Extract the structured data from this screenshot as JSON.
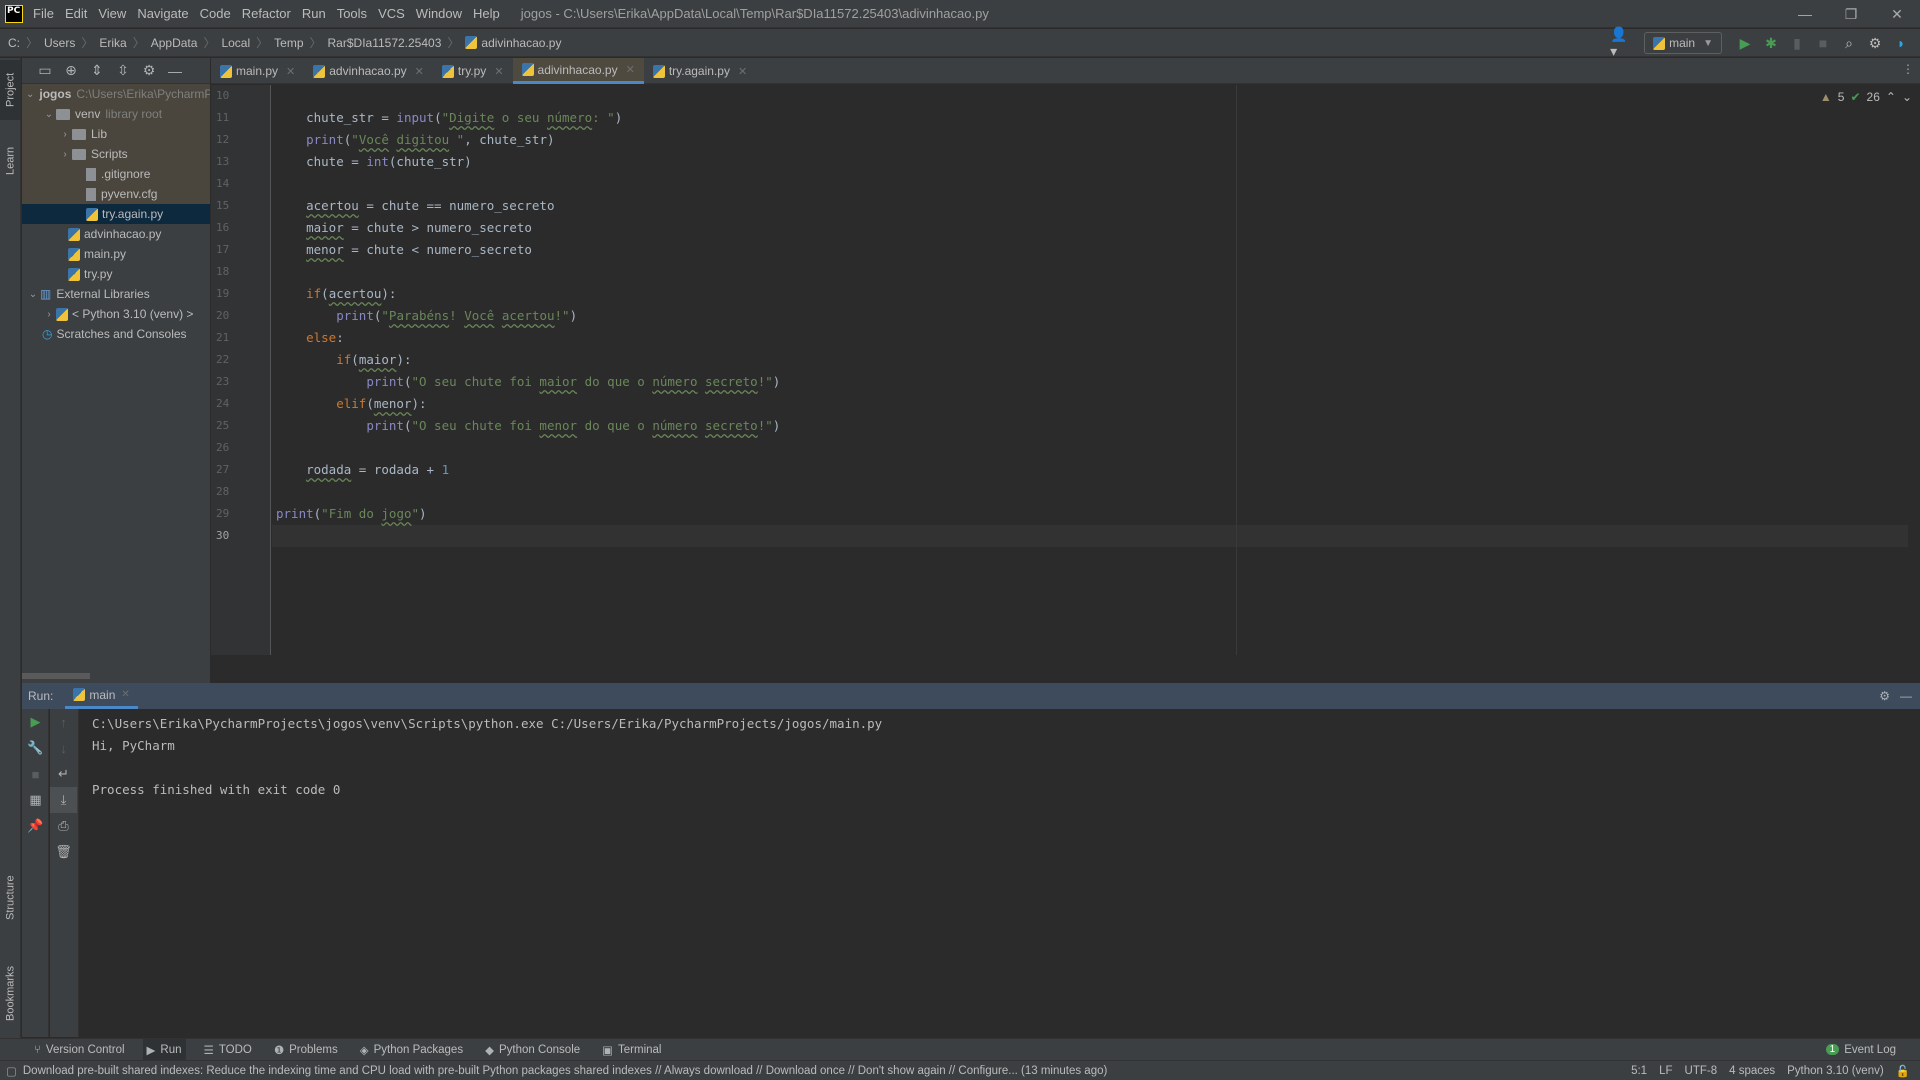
{
  "titlebar": {
    "logo": "PC",
    "menu": [
      "File",
      "Edit",
      "View",
      "Navigate",
      "Code",
      "Refactor",
      "Run",
      "Tools",
      "VCS",
      "Window",
      "Help"
    ],
    "title": "jogos - C:\\Users\\Erika\\AppData\\Local\\Temp\\Rar$DIa11572.25403\\adivinhacao.py",
    "controls": {
      "minimize": "—",
      "restore": "❐",
      "close": "✕"
    }
  },
  "navbar": {
    "breadcrumbs": [
      "C:",
      "Users",
      "Erika",
      "AppData",
      "Local",
      "Temp",
      "Rar$DIa11572.25403",
      "adivinhacao.py"
    ],
    "run_config": "main"
  },
  "left_stripe": {
    "tabs": [
      "Project",
      "Learn",
      "Structure",
      "Bookmarks"
    ]
  },
  "project_tree": [
    {
      "label": "jogos",
      "extra": "C:\\Users\\Erika\\PycharmProjects\\jogos",
      "type": "folder",
      "level": 0,
      "expanded": true
    },
    {
      "label": "venv",
      "extra": "library root",
      "type": "folder",
      "level": 1,
      "expanded": true
    },
    {
      "label": "Lib",
      "type": "folder",
      "level": 2,
      "expanded": false
    },
    {
      "label": "Scripts",
      "type": "folder",
      "level": 2,
      "expanded": false
    },
    {
      "label": ".gitignore",
      "type": "file",
      "level": 3
    },
    {
      "label": "pyvenv.cfg",
      "type": "file",
      "level": 3
    },
    {
      "label": "try.again.py",
      "type": "py",
      "level": 3,
      "selected": true
    },
    {
      "label": "advinhacao.py",
      "type": "py",
      "level": 2
    },
    {
      "label": "main.py",
      "type": "py",
      "level": 2
    },
    {
      "label": "try.py",
      "type": "py",
      "level": 2
    },
    {
      "label": "External Libraries",
      "type": "lib",
      "level": 0,
      "expanded": true
    },
    {
      "label": "< Python 3.10 (venv) >",
      "type": "python",
      "level": 1,
      "expanded": false
    },
    {
      "label": "Scratches and Consoles",
      "type": "scratch",
      "level": 0
    }
  ],
  "tabs": [
    {
      "label": "main.py",
      "active": false
    },
    {
      "label": "advinhacao.py",
      "active": false
    },
    {
      "label": "try.py",
      "active": false
    },
    {
      "label": "adivinhacao.py",
      "active": true
    },
    {
      "label": "try.again.py",
      "active": false
    }
  ],
  "inspections": {
    "warnings": "5",
    "typos": "26"
  },
  "editor": {
    "current_line": 30,
    "lines": [
      {
        "n": 10,
        "html": ""
      },
      {
        "n": 11,
        "html": "    chute_str = <span class='fn'>input</span>(<span class='st'>\"<span class='wv'>Digite</span> o seu <span class='wv'>número</span>: \"</span>)"
      },
      {
        "n": 12,
        "html": "    <span class='fn'>print</span>(<span class='st'>\"<span class='wv'>Você</span> <span class='wv'>digitou</span> \"</span>, chute_str)"
      },
      {
        "n": 13,
        "html": "    chute = <span class='fn'>int</span>(chute_str)"
      },
      {
        "n": 14,
        "html": ""
      },
      {
        "n": 15,
        "html": "    <span class='wv'>acertou</span> = chute == numero_secreto"
      },
      {
        "n": 16,
        "html": "    <span class='wv'>maior</span> = chute &gt; numero_secreto"
      },
      {
        "n": 17,
        "html": "    <span class='wv'>menor</span> = chute &lt; numero_secreto"
      },
      {
        "n": 18,
        "html": ""
      },
      {
        "n": 19,
        "html": "    <span class='kw'>if</span>(<span class='wv'>acertou</span>):"
      },
      {
        "n": 20,
        "html": "        <span class='fn'>print</span>(<span class='st'>\"<span class='wv'>Parabéns</span>! <span class='wv'>Você</span> <span class='wv'>acertou</span>!\"</span>)"
      },
      {
        "n": 21,
        "html": "    <span class='kw'>else</span>:"
      },
      {
        "n": 22,
        "html": "        <span class='kw'>if</span>(<span class='wv'>maior</span>):"
      },
      {
        "n": 23,
        "html": "            <span class='fn'>print</span>(<span class='st'>\"O seu chute foi <span class='wv'>maior</span> do que o <span class='wv'>número</span> <span class='wv'>secreto</span>!\"</span>)"
      },
      {
        "n": 24,
        "html": "        <span class='kw'>elif</span>(<span class='wv'>menor</span>):"
      },
      {
        "n": 25,
        "html": "            <span class='fn'>print</span>(<span class='st'>\"O seu chute foi <span class='wv'>menor</span> do que o <span class='wv'>número</span> <span class='wv'>secreto</span>!\"</span>)"
      },
      {
        "n": 26,
        "html": ""
      },
      {
        "n": 27,
        "html": "    <span class='wv'>rodada</span> = rodada + <span class='nm'>1</span>"
      },
      {
        "n": 28,
        "html": ""
      },
      {
        "n": 29,
        "html": "<span class='fn'>print</span>(<span class='st'>\"Fim do <span class='wv'>jogo</span>\"</span>)"
      },
      {
        "n": 30,
        "html": ""
      }
    ]
  },
  "run_panel": {
    "label": "Run:",
    "tab": "main",
    "output": [
      "C:\\Users\\Erika\\PycharmProjects\\jogos\\venv\\Scripts\\python.exe C:/Users/Erika/PycharmProjects/jogos/main.py",
      "Hi, PyCharm",
      "",
      "Process finished with exit code 0"
    ]
  },
  "tool_windows": [
    {
      "label": "Version Control",
      "icon": "branch-icon"
    },
    {
      "label": "Run",
      "icon": "run-icon",
      "active": true
    },
    {
      "label": "TODO",
      "icon": "list-icon"
    },
    {
      "label": "Problems",
      "icon": "problems-icon"
    },
    {
      "label": "Python Packages",
      "icon": "packages-icon"
    },
    {
      "label": "Python Console",
      "icon": "python-icon"
    },
    {
      "label": "Terminal",
      "icon": "terminal-icon"
    }
  ],
  "event_log": {
    "label": "Event Log",
    "count": "1"
  },
  "statusbar": {
    "message": "Download pre-built shared indexes: Reduce the indexing time and CPU load with pre-built Python packages shared indexes // Always download // Download once // Don't show again // Configure... (13 minutes ago)",
    "position": "5:1",
    "line_sep": "LF",
    "encoding": "UTF-8",
    "indent": "4 spaces",
    "interpreter": "Python 3.10 (venv)"
  },
  "colors": {
    "accent": "#4a88c7",
    "run_green": "#499c54",
    "selection": "#0d293e"
  }
}
